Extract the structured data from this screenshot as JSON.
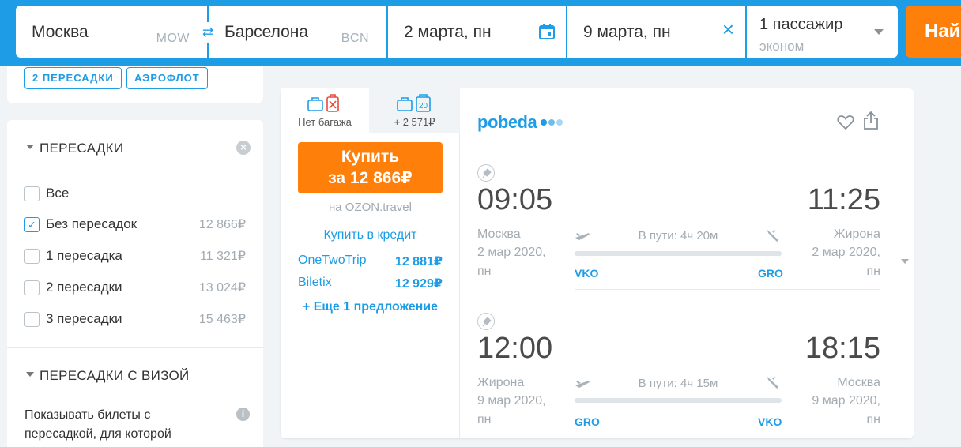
{
  "search": {
    "origin": "Москва",
    "origin_code": "MOW",
    "destination": "Барселона",
    "destination_code": "BCN",
    "depart_date": "2 марта, пн",
    "return_date": "9 марта, пн",
    "passengers": "1 пассажир",
    "cabin_class": "эконом",
    "search_button": "Най",
    "swap_icon": "swap-arrows-icon",
    "calendar_icon": "calendar-icon",
    "clear_icon": "close-icon"
  },
  "active_tags": [
    "2 ПЕРЕСАДКИ",
    "АЭРОФЛОТ"
  ],
  "filters": {
    "transfers_title": "ПЕРЕСАДКИ",
    "options": [
      {
        "label": "Все",
        "price": "",
        "checked": false
      },
      {
        "label": "Без пересадок",
        "price": "12 866₽",
        "checked": true
      },
      {
        "label": "1 пересадка",
        "price": "11 321₽",
        "checked": false
      },
      {
        "label": "2 пересадки",
        "price": "13 024₽",
        "checked": false
      },
      {
        "label": "3 пересадки",
        "price": "15 463₽",
        "checked": false
      }
    ],
    "visa_title": "ПЕРЕСАДКИ С ВИЗОЙ",
    "visa_description": "Показывать билеты с пересадкой, для которой"
  },
  "ticket": {
    "baggage_tabs": [
      {
        "label": "Нет багажа",
        "icon": "no-baggage-icon"
      },
      {
        "label": "+ 2 571₽",
        "icon": "baggage-20kg-icon",
        "badge": "20"
      }
    ],
    "buy_line1": "Купить",
    "buy_line2": "за 12 866₽",
    "agency": "на OZON.travel",
    "credit": "Купить в кредит",
    "offers": [
      {
        "name": "OneTwoTrip",
        "price": "12 881₽"
      },
      {
        "name": "Biletix",
        "price": "12 929₽"
      }
    ],
    "more_offers": "+ Еще 1 предложение",
    "airline": "pobeda",
    "segments": [
      {
        "dep_time": "09:05",
        "arr_time": "11:25",
        "dep_city": "Москва",
        "arr_city": "Жирона",
        "dep_date": "2 мар 2020,",
        "dep_day": "пн",
        "arr_date": "2 мар 2020,",
        "arr_day": "пн",
        "duration": "В пути: 4ч 20м",
        "dep_code": "VKO",
        "arr_code": "GRO"
      },
      {
        "dep_time": "12:00",
        "arr_time": "18:15",
        "dep_city": "Жирона",
        "arr_city": "Москва",
        "dep_date": "9 мар 2020,",
        "dep_day": "пн",
        "arr_date": "9 мар 2020,",
        "arr_day": "пн",
        "duration": "В пути: 4ч 15м",
        "dep_code": "GRO",
        "arr_code": "VKO"
      }
    ]
  },
  "colors": {
    "brand_blue": "#1e9de6",
    "accent_orange": "#ff7f0b",
    "background": "#f0f4f7"
  }
}
